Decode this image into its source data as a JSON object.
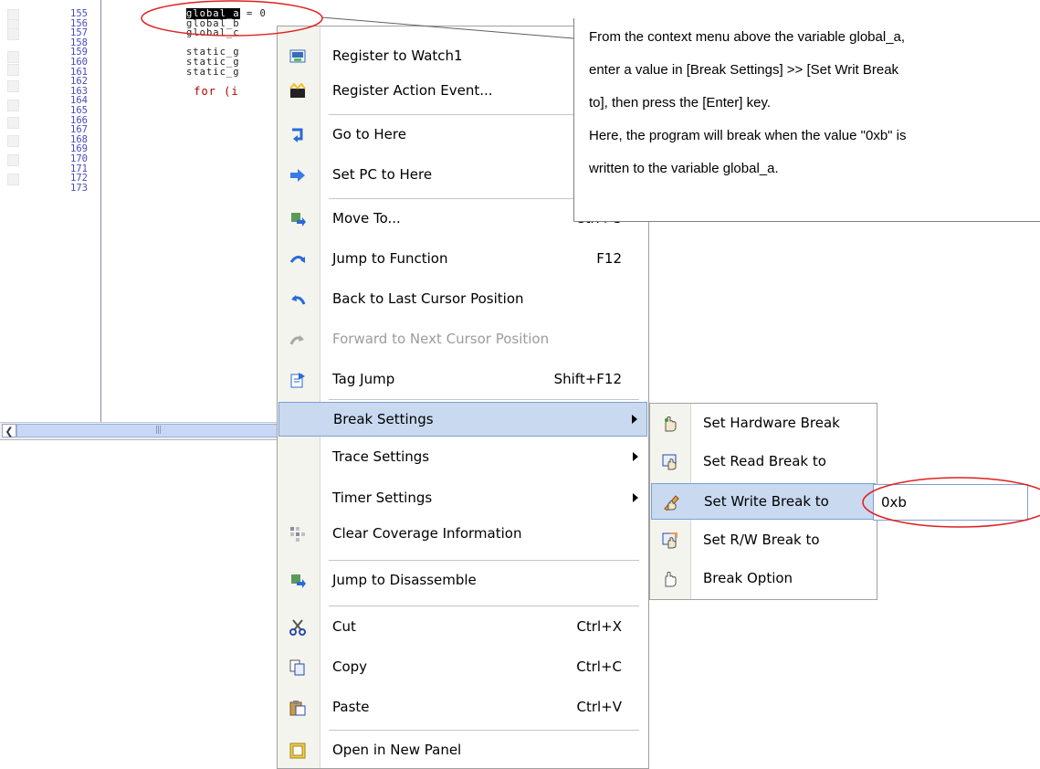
{
  "editor": {
    "lines": [
      {
        "num": "155",
        "code": ""
      },
      {
        "num": "156",
        "code": "global_b"
      },
      {
        "num": "157",
        "code": "global_c"
      },
      {
        "num": "158",
        "code": ""
      },
      {
        "num": "159",
        "code": "static_g"
      },
      {
        "num": "160",
        "code": "static_g"
      },
      {
        "num": "161",
        "code": "static_g"
      },
      {
        "num": "162",
        "code": ""
      },
      {
        "num": "163",
        "code": " for (i"
      },
      {
        "num": "164",
        "code": ""
      },
      {
        "num": "165",
        "code": ""
      },
      {
        "num": "166",
        "code": ""
      },
      {
        "num": "167",
        "code": ""
      },
      {
        "num": "168",
        "code": ""
      },
      {
        "num": "169",
        "code": ""
      },
      {
        "num": "170",
        "code": ""
      },
      {
        "num": "171",
        "code": ""
      },
      {
        "num": "172",
        "code": ""
      },
      {
        "num": "173",
        "code": ""
      }
    ],
    "selected_text": "global_a",
    "after_selection": " = 0"
  },
  "context_menu": {
    "items": [
      {
        "label": "Register to Watch1",
        "shortcut": "",
        "icon": "watch-icon"
      },
      {
        "label": "Register Action Event...",
        "shortcut": "",
        "icon": "action-event-icon"
      },
      {
        "label": "Go to Here",
        "shortcut": "",
        "icon": "go-to-here-icon"
      },
      {
        "label": "Set PC to Here",
        "shortcut": "",
        "icon": "set-pc-icon"
      },
      {
        "label": "Move To...",
        "shortcut": "Ctrl+G",
        "icon": "move-to-icon"
      },
      {
        "label": "Jump to Function",
        "shortcut": "F12",
        "icon": "jump-function-icon"
      },
      {
        "label": "Back to Last Cursor Position",
        "shortcut": "",
        "icon": "back-cursor-icon"
      },
      {
        "label": "Forward to Next Cursor Position",
        "shortcut": "",
        "icon": "forward-cursor-icon"
      },
      {
        "label": "Tag Jump",
        "shortcut": "Shift+F12",
        "icon": "tag-jump-icon"
      },
      {
        "label": "Break Settings",
        "shortcut": "",
        "icon": ""
      },
      {
        "label": "Trace Settings",
        "shortcut": "",
        "icon": ""
      },
      {
        "label": "Timer Settings",
        "shortcut": "",
        "icon": ""
      },
      {
        "label": "Clear Coverage Information",
        "shortcut": "",
        "icon": "coverage-icon"
      },
      {
        "label": "Jump to Disassemble",
        "shortcut": "",
        "icon": "disassemble-icon"
      },
      {
        "label": "Cut",
        "shortcut": "Ctrl+X",
        "icon": "scissors-icon"
      },
      {
        "label": "Copy",
        "shortcut": "Ctrl+C",
        "icon": "copy-icon"
      },
      {
        "label": "Paste",
        "shortcut": "Ctrl+V",
        "icon": "paste-icon"
      },
      {
        "label": "Open in New Panel",
        "shortcut": "",
        "icon": "new-panel-icon"
      }
    ]
  },
  "break_submenu": {
    "items": [
      {
        "label": "Set Hardware Break",
        "icon": "hardware-break-icon"
      },
      {
        "label": "Set Read Break to",
        "icon": "read-break-icon"
      },
      {
        "label": "Set Write Break to",
        "icon": "write-break-icon"
      },
      {
        "label": "Set R/W Break to",
        "icon": "rw-break-icon"
      },
      {
        "label": "Break Option",
        "icon": "break-option-icon"
      }
    ],
    "write_break_value": "0xb"
  },
  "callout": {
    "lines": [
      "From the context menu above the variable global_a,",
      "enter a value in [Break Settings] >> [Set Writ Break",
      "to], then press the [Enter] key.",
      "Here, the program will break when the value \"0xb\" is",
      "written to the variable global_a."
    ]
  },
  "colors": {
    "highlight": "#c8d9f0",
    "annotation_red": "#e02020",
    "line_number": "#4a4ac0",
    "keyword": "#b00000"
  }
}
